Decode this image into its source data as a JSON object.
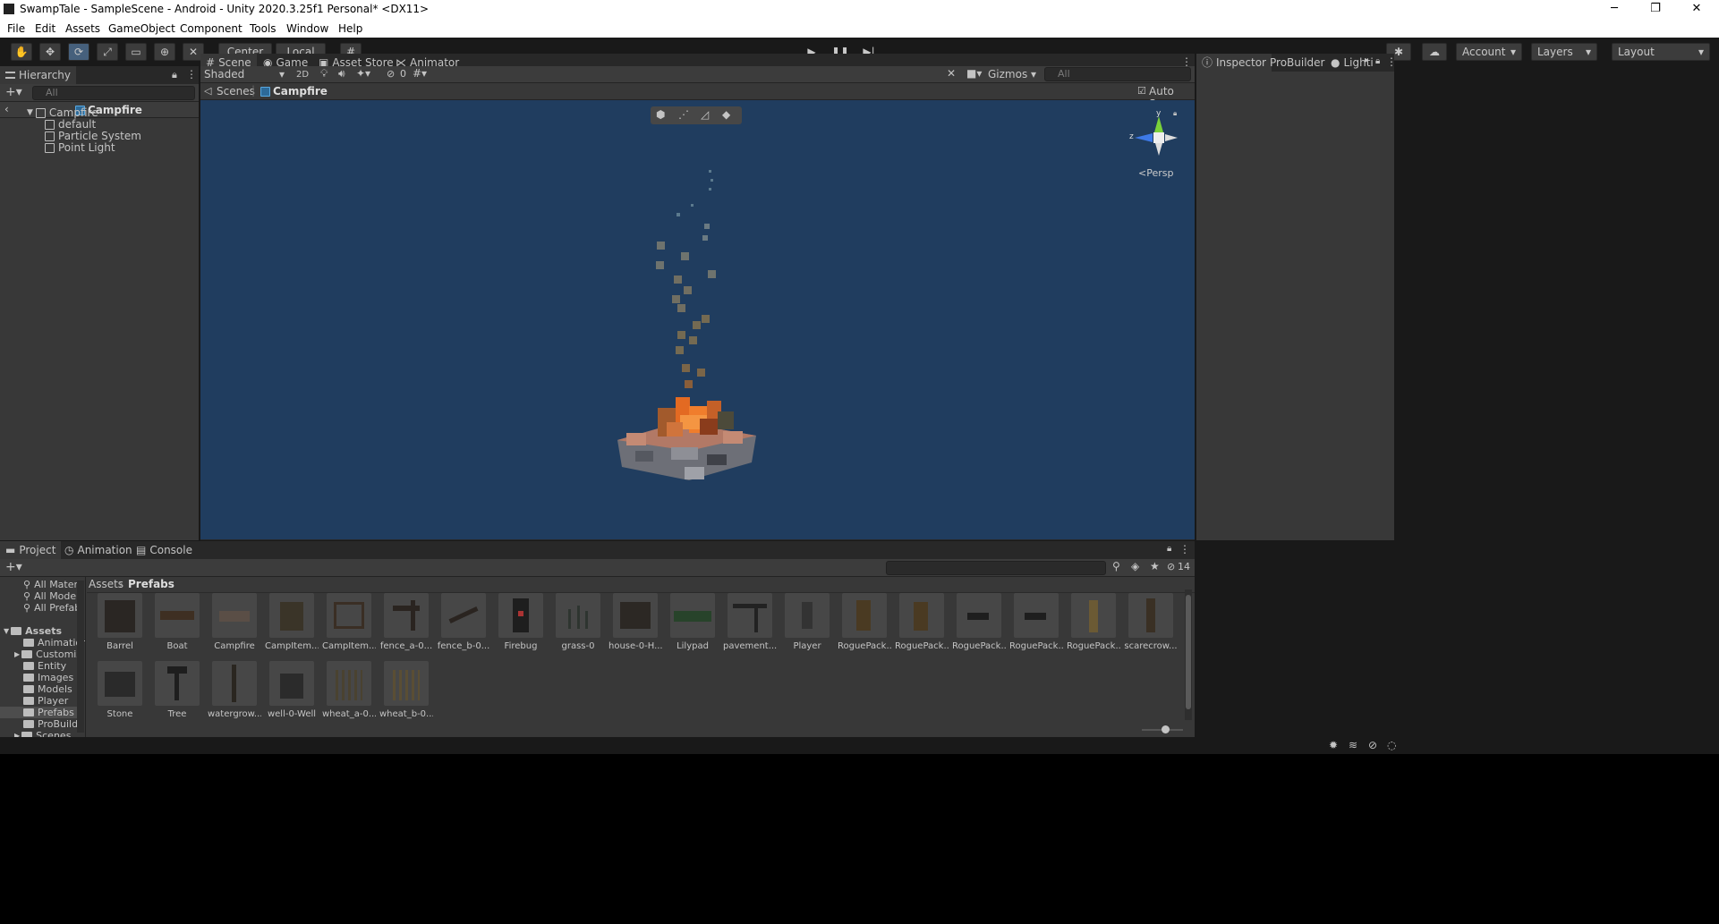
{
  "window": {
    "title": "SwampTale - SampleScene - Android - Unity 2020.3.25f1 Personal* <DX11>",
    "controls": [
      "─",
      "❐",
      "✕"
    ]
  },
  "menu": [
    "File",
    "Edit",
    "Assets",
    "GameObject",
    "Component",
    "Tools",
    "Window",
    "Help"
  ],
  "toolbar": {
    "pivot": "Center",
    "space": "Local",
    "account": "Account",
    "layers": "Layers",
    "layout": "Layout"
  },
  "hierarchy": {
    "tab": "Hierarchy",
    "search_placeholder": "All",
    "prefab_title": "Campfire",
    "items": [
      {
        "label": "Campfire",
        "depth": 0
      },
      {
        "label": "default",
        "depth": 1
      },
      {
        "label": "Particle System",
        "depth": 1
      },
      {
        "label": "Point Light",
        "depth": 1
      }
    ]
  },
  "scene": {
    "tabs": [
      "Scene",
      "Game",
      "Asset Store",
      "Animator"
    ],
    "shading": "Shaded",
    "mode_2d": "2D",
    "hidden_count": "0",
    "gizmos": "Gizmos",
    "search_placeholder": "All",
    "breadcrumb_root": "Scenes",
    "breadcrumb_current": "Campfire",
    "autosave": "Auto Save",
    "persp": "Persp",
    "axis": {
      "y": "y",
      "z": "z"
    }
  },
  "right": {
    "tabs": [
      "Inspector",
      "ProBuilder",
      "Lighti"
    ]
  },
  "project": {
    "tabs": [
      "Project",
      "Animation",
      "Console"
    ],
    "visible_count": "14",
    "breadcrumb_root": "Assets",
    "breadcrumb_current": "Prefabs",
    "favorites": [
      "All Materi",
      "All Model",
      "All Prefab"
    ],
    "tree_root": "Assets",
    "folders": [
      "Animation",
      "Customiz",
      "Entity",
      "Images",
      "Models",
      "Player",
      "Prefabs",
      "ProBuilde",
      "Scenes"
    ],
    "assets": [
      "Barrel",
      "Boat",
      "Campfire",
      "CampItem...",
      "CampItem...",
      "fence_a-0...",
      "fence_b-0...",
      "Firebug",
      "grass-0",
      "house-0-H...",
      "Lilypad",
      "pavement...",
      "Player",
      "RoguePack...",
      "RoguePack...",
      "RoguePack...",
      "RoguePack...",
      "RoguePack...",
      "scarecrow...",
      "Stone",
      "Tree",
      "watergrow...",
      "well-0-Well",
      "wheat_a-0...",
      "wheat_b-0..."
    ]
  }
}
